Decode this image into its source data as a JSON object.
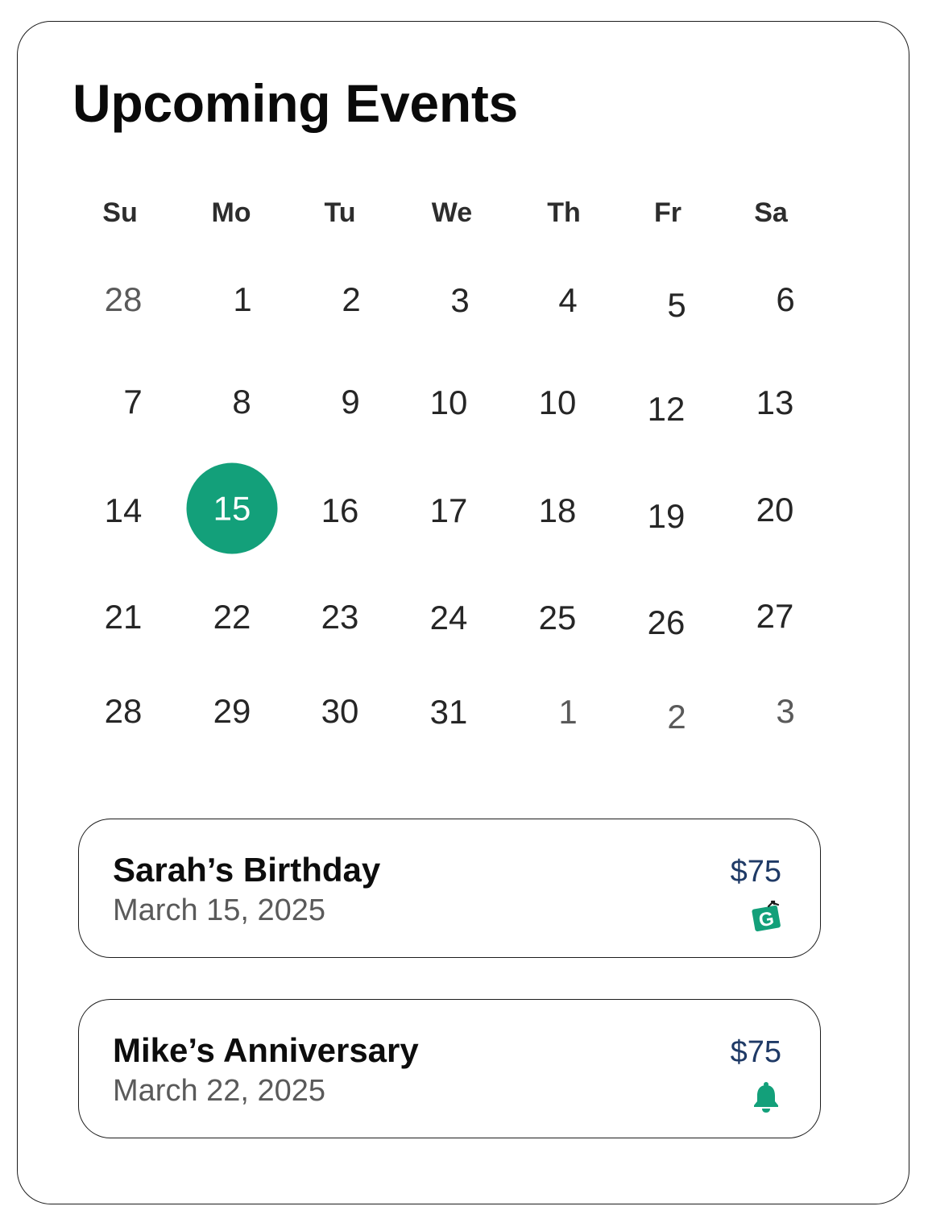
{
  "title": "Upcoming Events",
  "accent_color": "#13a07a",
  "calendar": {
    "weekdays": [
      "Su",
      "Mo",
      "Tu",
      "We",
      "Th",
      "Fr",
      "Sa"
    ],
    "selected_day": "15",
    "weeks": [
      [
        "28",
        "1",
        "2",
        "3",
        "4",
        "5",
        "6"
      ],
      [
        "7",
        "8",
        "9",
        "10",
        "10",
        "12",
        "13"
      ],
      [
        "14",
        "15",
        "16",
        "17",
        "18",
        "19",
        "20"
      ],
      [
        "21",
        "22",
        "23",
        "24",
        "25",
        "26",
        "27"
      ],
      [
        "28",
        "29",
        "30",
        "31",
        "1",
        "2",
        "3"
      ]
    ]
  },
  "events": [
    {
      "title": "Sarah’s Birthday",
      "date": "March 15, 2025",
      "price": "$75",
      "icon": "gift-card-icon"
    },
    {
      "title": "Mike’s Anniversary",
      "date": "March 22, 2025",
      "price": "$75",
      "icon": "bell-icon"
    }
  ]
}
